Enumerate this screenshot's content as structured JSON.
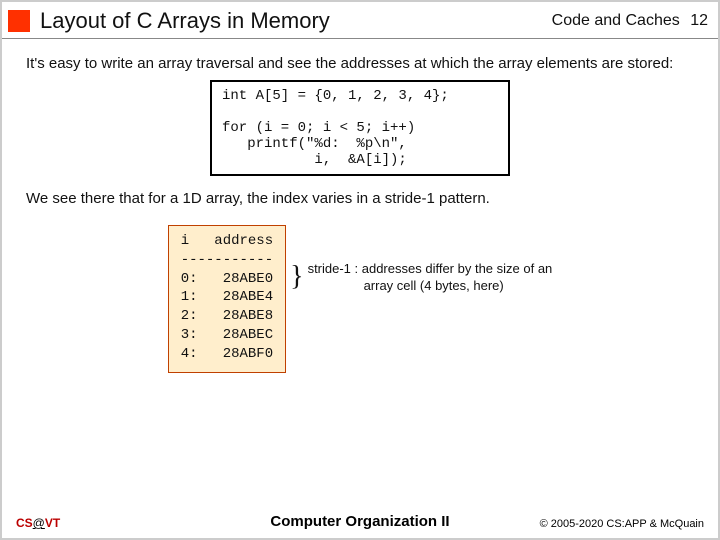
{
  "header": {
    "title": "Layout of C Arrays in Memory",
    "rightLabel": "Code and Caches",
    "pageNumber": "12"
  },
  "body": {
    "intro": "It's easy to write an array traversal and see the addresses at which the array elements are stored:",
    "code": "int A[5] = {0, 1, 2, 3, 4};\n\nfor (i = 0; i < 5; i++)\n   printf(\"%d:  %p\\n\",\n           i,  &A[i]);",
    "strideLine": "We see there that for a 1D array, the index varies in a stride-1 pattern.",
    "output": "i   address\n-----------\n0:   28ABE0\n1:   28ABE4\n2:   28ABE8\n3:   28ABEC\n4:   28ABF0",
    "brace": "}",
    "annotation1": "stride-1 : addresses differ by the size of an",
    "annotation2": "array cell (4 bytes, here)"
  },
  "footer": {
    "leftPrefix": "CS",
    "leftAt": "@",
    "leftSuffix": "VT",
    "center": "Computer Organization II",
    "right": "© 2005-2020 CS:APP & McQuain"
  }
}
